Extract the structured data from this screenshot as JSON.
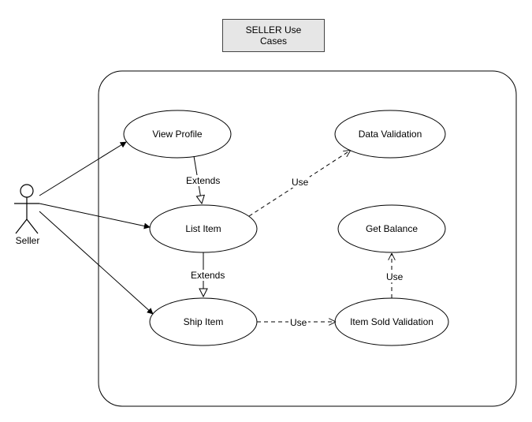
{
  "title": "SELLER Use Cases",
  "actor": {
    "name": "Seller"
  },
  "usecases": {
    "viewProfile": {
      "label": "View Profile"
    },
    "listItem": {
      "label": "List Item"
    },
    "shipItem": {
      "label": "Ship Item"
    },
    "dataValidation": {
      "label": "Data Validation"
    },
    "getBalance": {
      "label": "Get Balance"
    },
    "itemSoldValidation": {
      "label": "Item Sold Validation"
    }
  },
  "edges": {
    "extends1": "Extends",
    "extends2": "Extends",
    "use1": "Use",
    "use2": "Use",
    "use3": "Use"
  },
  "chart_data": {
    "type": "uml-use-case",
    "actors": [
      "Seller"
    ],
    "usecases": [
      "View Profile",
      "List Item",
      "Ship Item",
      "Data Validation",
      "Get Balance",
      "Item Sold Validation"
    ],
    "associations": [
      {
        "actor": "Seller",
        "usecase": "View Profile"
      },
      {
        "actor": "Seller",
        "usecase": "List Item"
      },
      {
        "actor": "Seller",
        "usecase": "Ship Item"
      }
    ],
    "extends": [
      {
        "from": "View Profile",
        "to": "List Item"
      },
      {
        "from": "List Item",
        "to": "Ship Item"
      }
    ],
    "uses": [
      {
        "from": "List Item",
        "to": "Data Validation"
      },
      {
        "from": "Ship Item",
        "to": "Item Sold Validation"
      },
      {
        "from": "Item Sold Validation",
        "to": "Get Balance"
      }
    ]
  }
}
